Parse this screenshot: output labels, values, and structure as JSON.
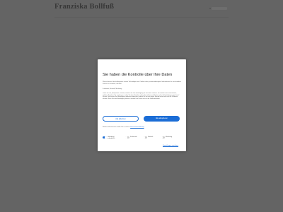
{
  "site": {
    "title": "Franziska Bollfuß"
  },
  "consent": {
    "title": "Sie haben die Kontrolle über Ihre Daten",
    "intro": "Wir und unsere Geschäftspartner nutzen Technologien wie Cookies dazu, personenbezogene Informationen für verschiedene Zwecke zu sammeln, darunter:",
    "purposes": "Funktional, Statistik, Marketing",
    "body": "Wenn Sie auf „Akzeptieren“ klicken, erteilen Sie Ihre Einwilligung für alle diese Zwecke. Sie können auch entscheiden, welchen Zwecken Sie zustimmen, indem Sie das Kästchen neben dem Zweck anklicken und auf „Einstellungen speichern“ klicken. Sie können Ihre Einwilligung jederzeit widerrufen, indem Sie auf das kleine Symbol unten links auf der Webseite klicken. Wenn Sie eine Einwilligung erteilen, werden Ihre Daten auch in die USA übermittelt.",
    "more_text": "Weitere Informationen finden Sie in unserer",
    "more_link": "Datenschutzerklärung",
    "reject_label": "Alle ablehnen",
    "accept_label": "Alle akzeptieren",
    "toggles": [
      {
        "label": "Unbedingt erforderlich",
        "on": true
      },
      {
        "label": "Funktional",
        "on": false
      },
      {
        "label": "Statistik",
        "on": false
      },
      {
        "label": "Marketing",
        "on": false
      }
    ],
    "save_label": "Einstellungen speichern"
  }
}
